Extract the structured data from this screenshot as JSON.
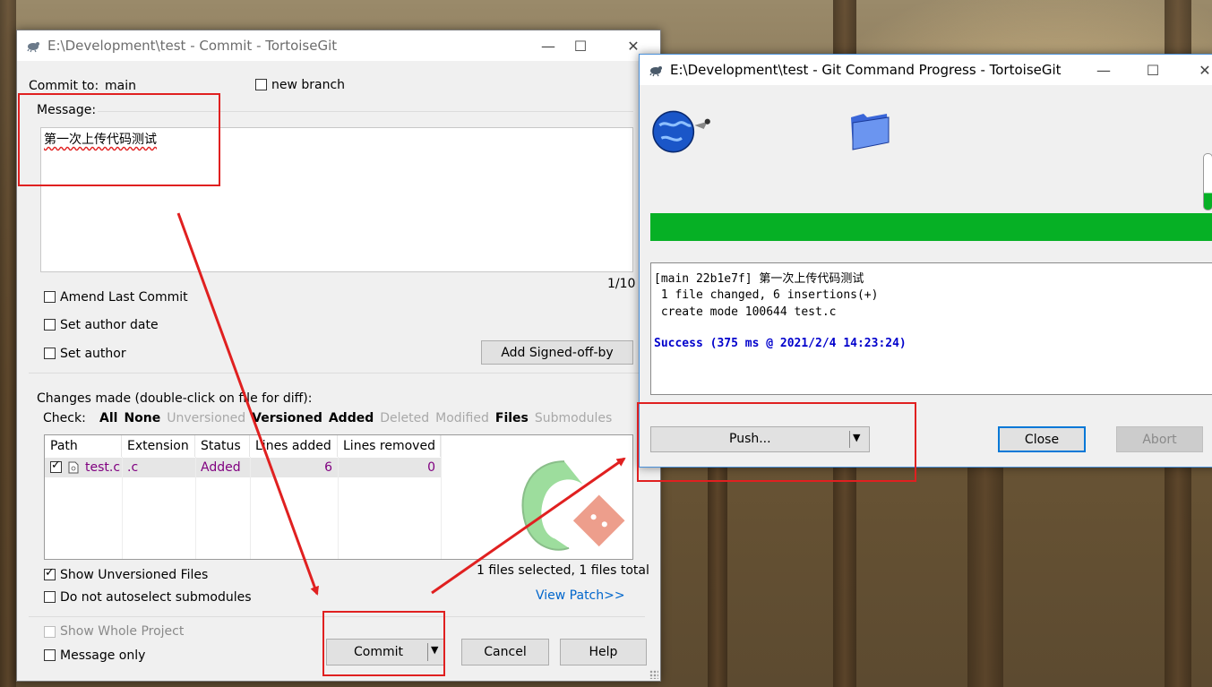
{
  "commit_window": {
    "title": "E:\\Development\\test - Commit - TortoiseGit",
    "commit_to_label": "Commit to:",
    "branch": "main",
    "new_branch_label": "new branch",
    "message_label": "Message:",
    "message_text": "第一次上传代码测试",
    "counter": "1/10",
    "amend_label": "Amend Last Commit",
    "set_author_date_label": "Set author date",
    "set_author_label": "Set author",
    "signed_off_label": "Add Signed-off-by",
    "changes_label": "Changes made (double-click on file for diff):",
    "check_label": "Check:",
    "check_filters": [
      {
        "label": "All",
        "style": "bold"
      },
      {
        "label": "None",
        "style": "bold"
      },
      {
        "label": "Unversioned",
        "style": "grey"
      },
      {
        "label": "Versioned",
        "style": "bold"
      },
      {
        "label": "Added",
        "style": "bold"
      },
      {
        "label": "Deleted",
        "style": "grey"
      },
      {
        "label": "Modified",
        "style": "grey"
      },
      {
        "label": "Files",
        "style": "bold"
      },
      {
        "label": "Submodules",
        "style": "grey"
      }
    ],
    "table": {
      "headers": [
        "Path",
        "Extension",
        "Status",
        "Lines added",
        "Lines removed"
      ],
      "rows": [
        {
          "path": "test.c",
          "extension": ".c",
          "status": "Added",
          "lines_added": "6",
          "lines_removed": "0",
          "checked": true
        }
      ]
    },
    "show_unversioned_label": "Show Unversioned Files",
    "no_autoselect_label": "Do not autoselect submodules",
    "files_summary": "1 files selected, 1 files total",
    "view_patch_label": "View Patch>>",
    "show_whole_project_label": "Show Whole Project",
    "message_only_label": "Message only",
    "commit_label": "Commit",
    "cancel_label": "Cancel",
    "help_label": "Help"
  },
  "progress_window": {
    "title": "E:\\Development\\test - Git Command Progress - TortoiseGit",
    "progress_percent": 100,
    "output_lines": [
      "[main 22b1e7f] 第一次上传代码测试",
      " 1 file changed, 6 insertions(+)",
      " create mode 100644 test.c"
    ],
    "success_line": "Success (375 ms @ 2021/2/4 14:23:24)",
    "push_label": "Push...",
    "close_label": "Close",
    "abort_label": "Abort"
  },
  "colors": {
    "progress_green": "#06b025",
    "annotation_red": "#e02020",
    "success_blue": "#0000cc",
    "link_blue": "#0066cc",
    "status_purple": "#800080"
  },
  "icons": [
    "tortoisegit-icon",
    "globe-icon",
    "folder-icon",
    "tortoisegit-watermark-icon",
    "dropdown-arrow-icon",
    "minimize-icon",
    "maximize-icon",
    "close-icon"
  ]
}
